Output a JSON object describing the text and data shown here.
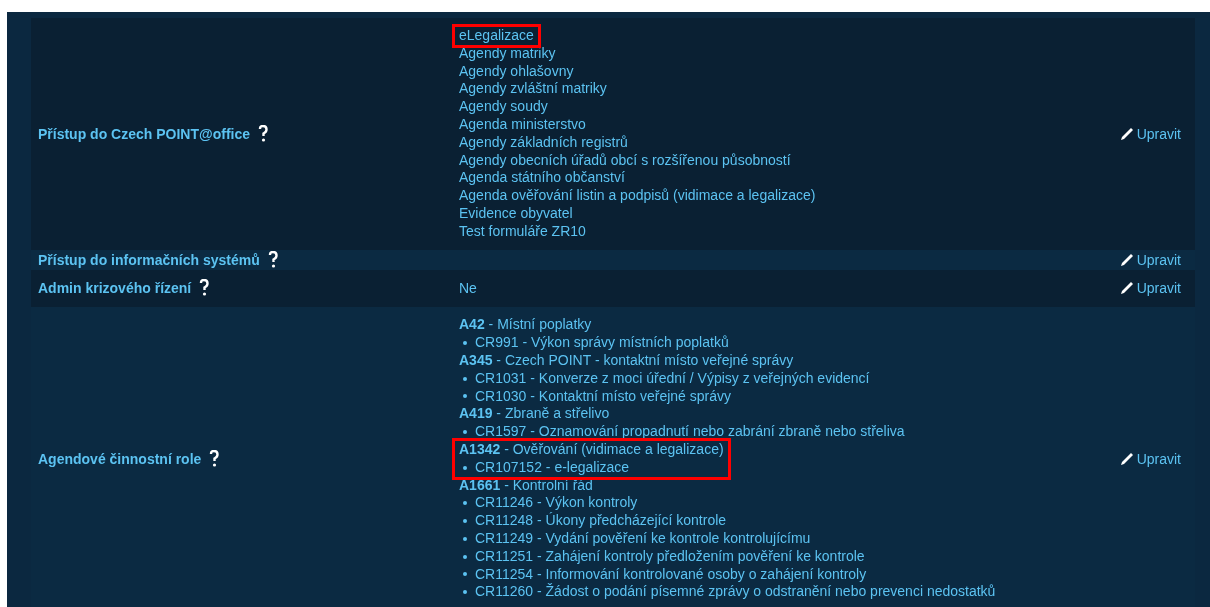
{
  "rows": [
    {
      "label": "Přístup do Czech POINT@office",
      "kind": "list",
      "items": [
        {
          "text": "eLegalizace",
          "highlighted": true
        },
        {
          "text": "Agendy matriky",
          "highlighted": false
        },
        {
          "text": "Agendy ohlašovny",
          "highlighted": false
        },
        {
          "text": "Agendy zvláštní matriky",
          "highlighted": false
        },
        {
          "text": "Agendy soudy",
          "highlighted": false
        },
        {
          "text": "Agenda ministerstvo",
          "highlighted": false
        },
        {
          "text": "Agendy základních registrů",
          "highlighted": false
        },
        {
          "text": "Agendy obecních úřadů obcí s rozšířenou působností",
          "highlighted": false
        },
        {
          "text": "Agenda státního občanství",
          "highlighted": false
        },
        {
          "text": "Agenda ověřování listin a podpisů (vidimace a legalizace)",
          "highlighted": false
        },
        {
          "text": "Evidence obyvatel",
          "highlighted": false
        },
        {
          "text": "Test formuláře ZR10",
          "highlighted": false
        }
      ],
      "action": "Upravit"
    },
    {
      "label": "Přístup do informačních systémů",
      "kind": "empty",
      "action": "Upravit"
    },
    {
      "label": "Admin krizového řízení",
      "kind": "text",
      "value": "Ne",
      "action": "Upravit"
    },
    {
      "label": "Agendové činnostní role",
      "kind": "agendas",
      "groups": [
        {
          "title": "**A42** - Místní poplatky",
          "highlighted": false,
          "roles": [
            "CR991 - Výkon správy místních poplatků"
          ]
        },
        {
          "title": "**A345** - Czech POINT - kontaktní místo veřejné správy",
          "highlighted": false,
          "roles": [
            "CR1031 - Konverze z moci úřední / Výpisy z veřejných evidencí",
            "CR1030 - Kontaktní místo veřejné správy"
          ]
        },
        {
          "title": "**A419** - Zbraně a střelivo",
          "highlighted": false,
          "roles": [
            "CR1597 - Oznamování propadnutí nebo zabrání zbraně nebo střeliva"
          ]
        },
        {
          "title": "**A1342** - Ověřování (vidimace a legalizace)",
          "highlighted": true,
          "roles": [
            "CR107152 - e-legalizace"
          ]
        },
        {
          "title": "**A1661** - Kontrolní řád",
          "highlighted": false,
          "roles": [
            "CR11246 - Výkon kontroly",
            "CR11248 - Úkony předcházející kontrole",
            "CR11249 - Vydání pověření ke kontrole kontrolujícímu",
            "CR11251 - Zahájení kontroly předložením pověření ke kontrole",
            "CR11254 - Informování kontrolované osoby o zahájení kontroly",
            "CR11260 - Žádost o podání písemné zprávy o odstranění nebo prevenci nedostatků"
          ]
        }
      ],
      "action": "Upravit"
    }
  ]
}
